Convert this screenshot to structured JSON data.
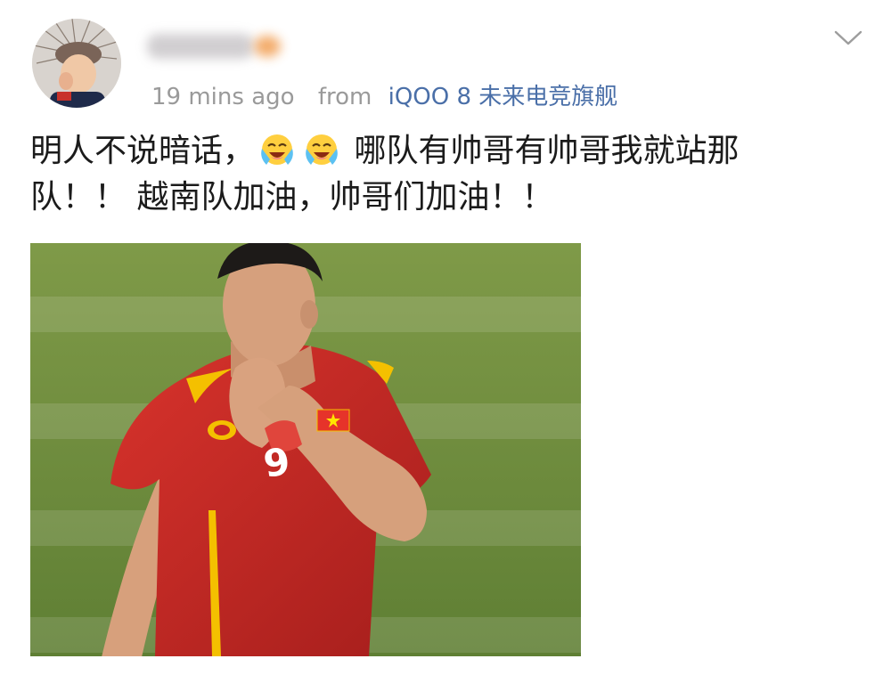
{
  "post": {
    "username": "",
    "timestamp": "19 mins ago",
    "source_prefix": "from",
    "device": "iQOO 8 未来电竞旗舰",
    "text_line1_a": "明人不说暗话，",
    "text_line1_b": "哪队有帅哥有帅哥我就站那",
    "text_line2": "队！！ 越南队加油，帅哥们加油！！",
    "emoji_icons": [
      "laughing-crying-emoji-icon",
      "laughing-crying-emoji-icon"
    ],
    "photo_jersey_number": "9"
  },
  "colors": {
    "meta_gray": "#9a9a9a",
    "device_link": "#4a6fa8",
    "text": "#1b1b1b",
    "jersey_red": "#c82a25",
    "jersey_yellow": "#f4c000",
    "pitch_green": "#6f8f3b"
  },
  "icons": {
    "dropdown": "chevron-down-icon"
  }
}
